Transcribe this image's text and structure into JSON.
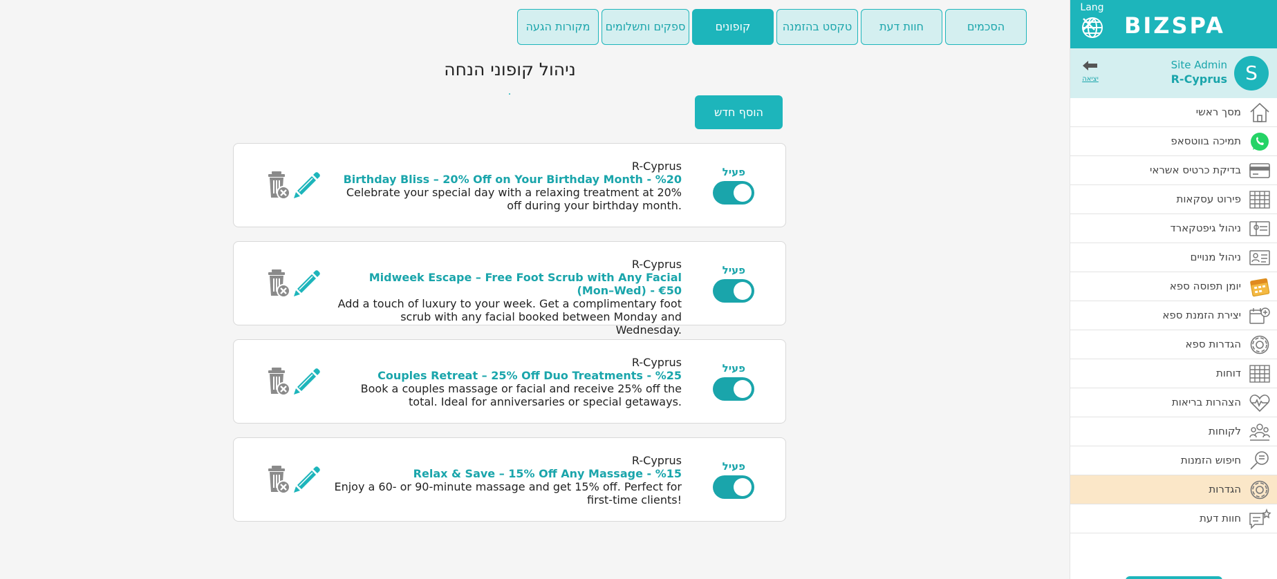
{
  "colors": {
    "accent": "#1db5bb",
    "accent_dark": "#1aa5ab",
    "tab_bg": "#d4eff0",
    "active_menu_bg": "#fbe7c8"
  },
  "tabs": [
    {
      "label": "הסכמים",
      "active": false
    },
    {
      "label": "חוות דעת",
      "active": false
    },
    {
      "label": "טקסט בהזמנה",
      "active": false
    },
    {
      "label": "קופונים",
      "active": true
    },
    {
      "label": "ספקים ותשלומים",
      "active": false
    },
    {
      "label": "מקורות הגעה",
      "active": false
    }
  ],
  "main": {
    "title": "ניהול קופוני הנחה",
    "add_button": "הוסף חדש"
  },
  "coupons": [
    {
      "status": "פעיל",
      "enabled": true,
      "business": "R-Cyprus",
      "title": "Birthday Bliss – 20% Off on Your Birthday Month - %20",
      "description": "Celebrate your special day with a relaxing treatment at 20% off during your birthday month."
    },
    {
      "status": "פעיל",
      "enabled": true,
      "business": "R-Cyprus",
      "title": "Midweek Escape – Free Foot Scrub with Any Facial (Mon–Wed) - €50",
      "description": "Add a touch of luxury to your week. Get a complimentary foot scrub with any facial booked between Monday and Wednesday."
    },
    {
      "status": "פעיל",
      "enabled": true,
      "business": "R-Cyprus",
      "title": "Couples Retreat – 25% Off Duo Treatments - %25",
      "description": "Book a couples massage or facial and receive 25% off the total. Ideal for anniversaries or special getaways."
    },
    {
      "status": "פעיל",
      "enabled": true,
      "business": "R-Cyprus",
      "title": "Relax & Save – 15% Off Any Massage - %15",
      "description": "Enjoy a 60- or 90-minute massage and get 15% off. Perfect for first-time clients!"
    }
  ],
  "sidebar": {
    "lang_label": "Lang",
    "logo": "BIZSPA",
    "user_name": "Site Admin",
    "user_business": "R-Cyprus",
    "avatar_letter": "S",
    "logout_label": "יציאה",
    "items": [
      {
        "label": "מסך ראשי",
        "icon": "home-icon",
        "active": false
      },
      {
        "label": "תמיכה בווטסאפ",
        "icon": "whatsapp-icon",
        "active": false
      },
      {
        "label": "בדיקת כרטיס אשראי",
        "icon": "credit-card-icon",
        "active": false
      },
      {
        "label": "פירוט עסקאות",
        "icon": "table-icon",
        "active": false
      },
      {
        "label": "ניהול גיפטקארד",
        "icon": "giftcard-icon",
        "active": false
      },
      {
        "label": "ניהול מנויים",
        "icon": "id-card-icon",
        "active": false
      },
      {
        "label": "יומן תפוסה ספא",
        "icon": "calendar-icon",
        "active": false
      },
      {
        "label": "יצירת הזמנת ספא",
        "icon": "add-booking-icon",
        "active": false
      },
      {
        "label": "הגדרות ספא",
        "icon": "gear-icon",
        "active": false
      },
      {
        "label": "דוחות",
        "icon": "report-table-icon",
        "active": false
      },
      {
        "label": "הצהרות בריאות",
        "icon": "heartbeat-icon",
        "active": false
      },
      {
        "label": "לקוחות",
        "icon": "customers-icon",
        "active": false
      },
      {
        "label": "חיפוש הזמנות",
        "icon": "search-bookings-icon",
        "active": false
      },
      {
        "label": "הגדרות",
        "icon": "settings-gear-icon",
        "active": true
      },
      {
        "label": "חוות דעת",
        "icon": "feedback-icon",
        "active": false
      }
    ]
  }
}
